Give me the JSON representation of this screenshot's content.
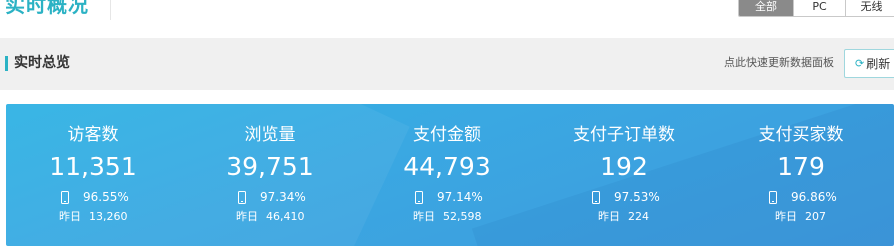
{
  "header": {
    "title": "实时概况",
    "segments": [
      {
        "label": "全部",
        "active": true
      },
      {
        "label": "PC",
        "active": false
      },
      {
        "label": "无线",
        "active": false
      }
    ]
  },
  "overview": {
    "title": "实时总览",
    "hint": "点此快速更新数据面板",
    "refresh_icon": "⟳",
    "refresh_label": "刷新"
  },
  "metrics": [
    {
      "label": "访客数",
      "value": "11,351",
      "wireless_pct": "96.55%",
      "yesterday_label": "昨日",
      "yesterday_value": "13,260"
    },
    {
      "label": "浏览量",
      "value": "39,751",
      "wireless_pct": "97.34%",
      "yesterday_label": "昨日",
      "yesterday_value": "46,410"
    },
    {
      "label": "支付金额",
      "value": "44,793",
      "wireless_pct": "97.14%",
      "yesterday_label": "昨日",
      "yesterday_value": "52,598"
    },
    {
      "label": "支付子订单数",
      "value": "192",
      "wireless_pct": "97.53%",
      "yesterday_label": "昨日",
      "yesterday_value": "224"
    },
    {
      "label": "支付买家数",
      "value": "179",
      "wireless_pct": "96.86%",
      "yesterday_label": "昨日",
      "yesterday_value": "207"
    }
  ],
  "colors": {
    "accent": "#2bb2c4",
    "panel_start": "#2fb2e4",
    "panel_end": "#3f99dd",
    "segment_active": "#8a8a8a"
  }
}
